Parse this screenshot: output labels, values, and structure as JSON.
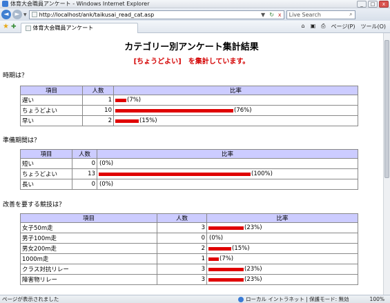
{
  "window": {
    "title": "体育大会職員アンケート - Windows Internet Explorer",
    "btn_min": "_",
    "btn_max": "□",
    "btn_close": "x"
  },
  "address": {
    "url": "http://localhost/ank/taikusai_read_cat.asp",
    "search_placeholder": "Live Search",
    "back_icon": "◄",
    "forward_icon": "►",
    "dropdown": "▼",
    "refresh_icon": "↻",
    "stop_icon": "x",
    "search_icon": "⌕"
  },
  "toolbar": {
    "tab_title": "体育大会職員アンケート",
    "home_icon": "⌂",
    "feed_icon": "▣",
    "print_icon": "⎙",
    "page_menu": "ページ(P)",
    "tools_menu": "ツール(O)"
  },
  "page": {
    "heading": "カテゴリー別アンケート集計結果",
    "subheading": "[ちょうどよい]　を集計しています。"
  },
  "tables": [
    {
      "question": "時期は？",
      "headers": {
        "item": "項目",
        "count": "人数",
        "ratio": "比率"
      },
      "rows": [
        {
          "item": "遅い",
          "count": "1",
          "pct_text": "(7%)",
          "pct": 7
        },
        {
          "item": "ちょうどよい",
          "count": "10",
          "pct_text": "(76%)",
          "pct": 76
        },
        {
          "item": "早い",
          "count": "2",
          "pct_text": "(15%)",
          "pct": 15
        }
      ]
    },
    {
      "question": "準備期間は？",
      "headers": {
        "item": "項目",
        "count": "人数",
        "ratio": "比率"
      },
      "rows": [
        {
          "item": "短い",
          "count": "0",
          "pct_text": "(0%)",
          "pct": 0
        },
        {
          "item": "ちょうどよい",
          "count": "13",
          "pct_text": "(100%)",
          "pct": 100
        },
        {
          "item": "長い",
          "count": "0",
          "pct_text": "(0%)",
          "pct": 0
        }
      ]
    },
    {
      "question": "改善を要する競技は？",
      "headers": {
        "item": "項目",
        "count": "人数",
        "ratio": "比率"
      },
      "rows": [
        {
          "item": "女子50m走",
          "count": "3",
          "pct_text": "(23%)",
          "pct": 23
        },
        {
          "item": "男子100m走",
          "count": "0",
          "pct_text": "(0%)",
          "pct": 0
        },
        {
          "item": "男女200m走",
          "count": "2",
          "pct_text": "(15%)",
          "pct": 15
        },
        {
          "item": "1000m走",
          "count": "1",
          "pct_text": "(7%)",
          "pct": 7
        },
        {
          "item": "クラス対抗リレー",
          "count": "3",
          "pct_text": "(23%)",
          "pct": 23
        },
        {
          "item": "障害物リレー",
          "count": "3",
          "pct_text": "(23%)",
          "pct": 23
        }
      ]
    }
  ],
  "status": {
    "left": "ページが表示されました",
    "zone": "ローカル イントラネット | 保護モード: 無効",
    "zoom": "100%"
  }
}
